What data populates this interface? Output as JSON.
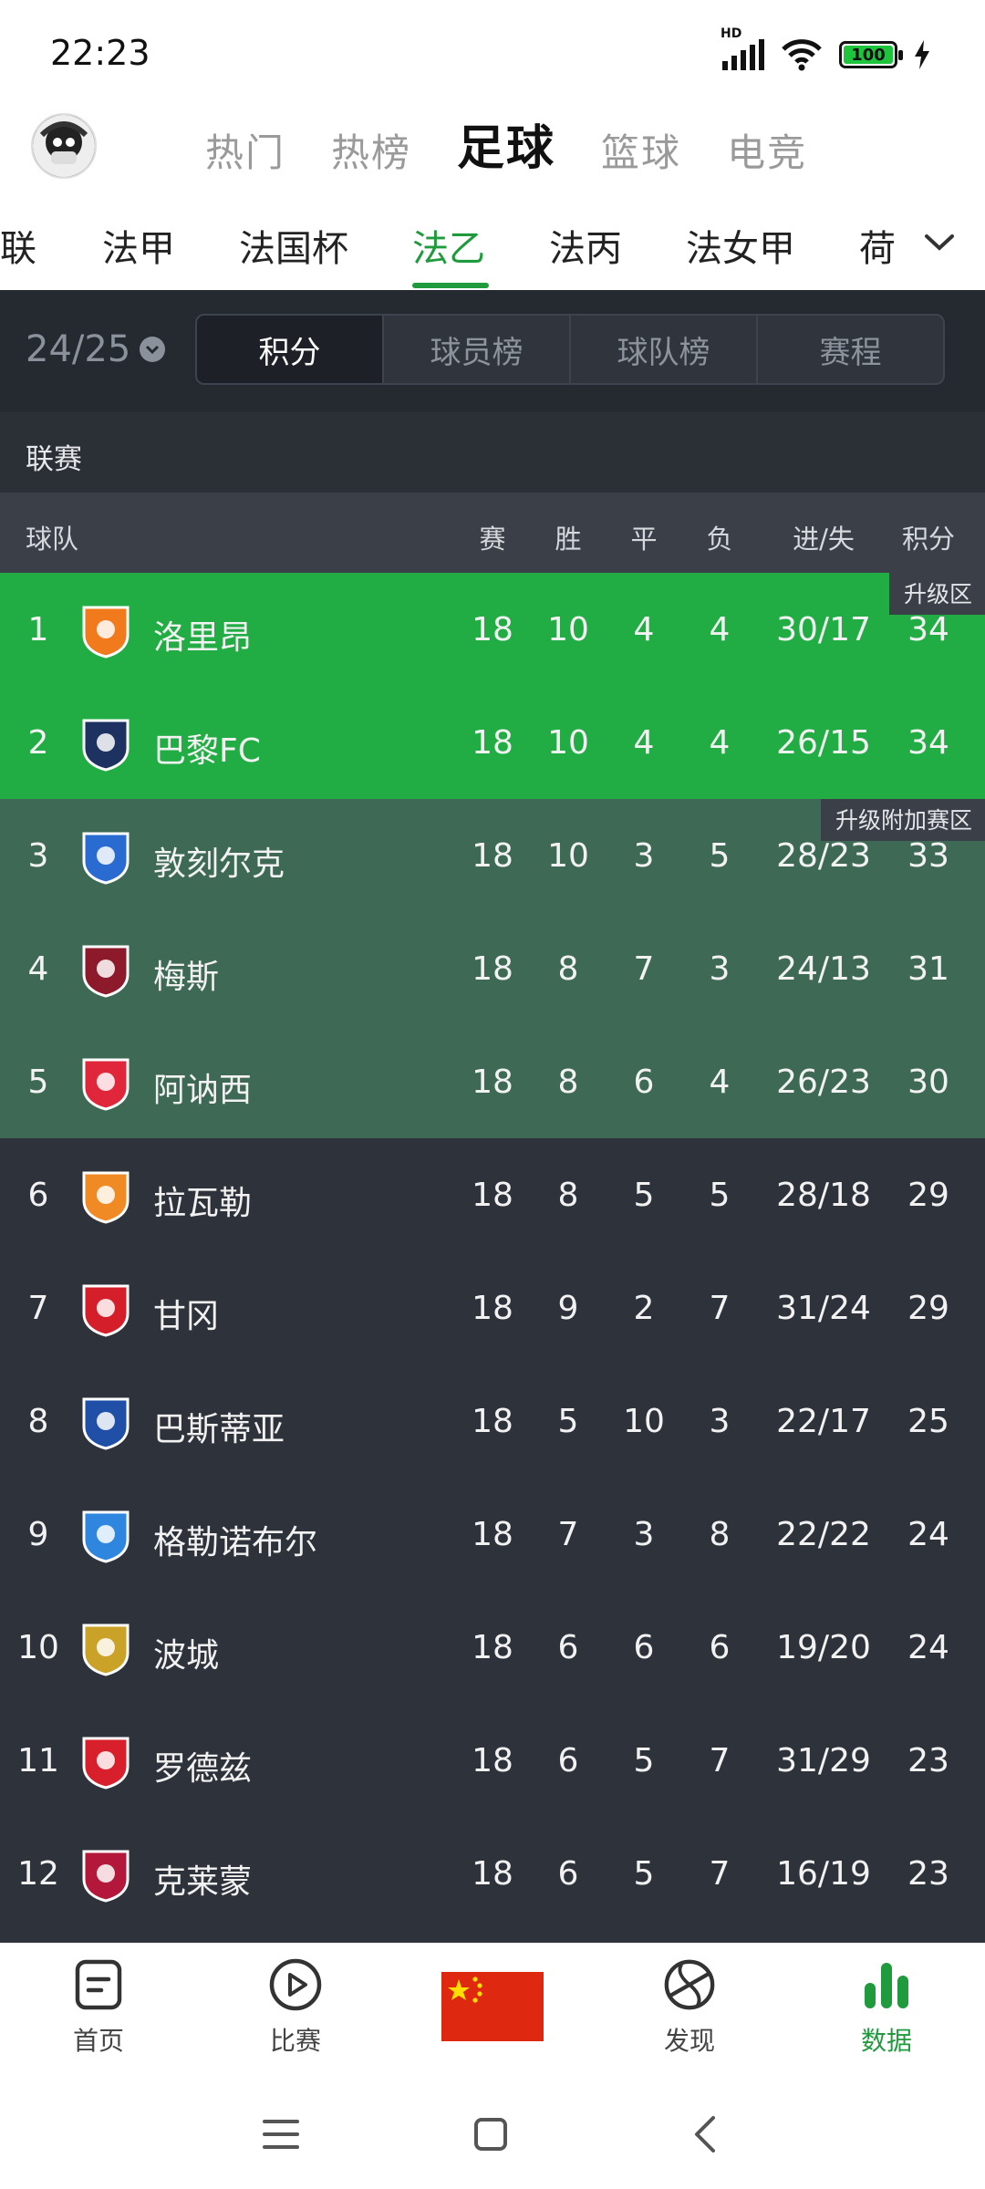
{
  "status": {
    "time": "22:23",
    "hd": "HD",
    "battery": "100"
  },
  "top_categories": [
    {
      "label": "热门",
      "active": false
    },
    {
      "label": "热榜",
      "active": false
    },
    {
      "label": "足球",
      "active": true
    },
    {
      "label": "篮球",
      "active": false
    },
    {
      "label": "电竞",
      "active": false
    }
  ],
  "league_tabs": [
    {
      "label": "联",
      "active": false
    },
    {
      "label": "法甲",
      "active": false
    },
    {
      "label": "法国杯",
      "active": false
    },
    {
      "label": "法乙",
      "active": true
    },
    {
      "label": "法丙",
      "active": false
    },
    {
      "label": "法女甲",
      "active": false
    },
    {
      "label": "荷",
      "active": false
    }
  ],
  "season": "24/25",
  "segments": [
    {
      "label": "积分",
      "active": true
    },
    {
      "label": "球员榜",
      "active": false
    },
    {
      "label": "球队榜",
      "active": false
    },
    {
      "label": "赛程",
      "active": false
    }
  ],
  "section_title": "联赛",
  "columns": {
    "team": "球队",
    "played": "赛",
    "win": "胜",
    "draw": "平",
    "loss": "负",
    "goals": "进/失",
    "points": "积分"
  },
  "zones": {
    "promotion": "升级区",
    "playoff": "升级附加赛区"
  },
  "standings": [
    {
      "rank": "1",
      "team": "洛里昂",
      "played": "18",
      "win": "10",
      "draw": "4",
      "loss": "4",
      "goals": "30/17",
      "points": "34",
      "zone": "promo",
      "crest": "lorient-crest-icon",
      "color": "#f07a1c"
    },
    {
      "rank": "2",
      "team": "巴黎FC",
      "played": "18",
      "win": "10",
      "draw": "4",
      "loss": "4",
      "goals": "26/15",
      "points": "34",
      "zone": "promo",
      "crest": "paris-fc-crest-icon",
      "color": "#1e3262"
    },
    {
      "rank": "3",
      "team": "敦刻尔克",
      "played": "18",
      "win": "10",
      "draw": "3",
      "loss": "5",
      "goals": "28/23",
      "points": "33",
      "zone": "playoff",
      "crest": "dunkerque-crest-icon",
      "color": "#2a6bd1"
    },
    {
      "rank": "4",
      "team": "梅斯",
      "played": "18",
      "win": "8",
      "draw": "7",
      "loss": "3",
      "goals": "24/13",
      "points": "31",
      "zone": "playoff",
      "crest": "metz-crest-icon",
      "color": "#8d1a2a"
    },
    {
      "rank": "5",
      "team": "阿讷西",
      "played": "18",
      "win": "8",
      "draw": "6",
      "loss": "4",
      "goals": "26/23",
      "points": "30",
      "zone": "playoff",
      "crest": "annecy-crest-icon",
      "color": "#e0263a"
    },
    {
      "rank": "6",
      "team": "拉瓦勒",
      "played": "18",
      "win": "8",
      "draw": "5",
      "loss": "5",
      "goals": "28/18",
      "points": "29",
      "zone": "normal",
      "crest": "laval-crest-icon",
      "color": "#f08a24"
    },
    {
      "rank": "7",
      "team": "甘冈",
      "played": "18",
      "win": "9",
      "draw": "2",
      "loss": "7",
      "goals": "31/24",
      "points": "29",
      "zone": "normal",
      "crest": "guingamp-crest-icon",
      "color": "#d41f2b"
    },
    {
      "rank": "8",
      "team": "巴斯蒂亚",
      "played": "18",
      "win": "5",
      "draw": "10",
      "loss": "3",
      "goals": "22/17",
      "points": "25",
      "zone": "normal",
      "crest": "bastia-crest-icon",
      "color": "#1f4fa6"
    },
    {
      "rank": "9",
      "team": "格勒诺布尔",
      "played": "18",
      "win": "7",
      "draw": "3",
      "loss": "8",
      "goals": "22/22",
      "points": "24",
      "zone": "normal",
      "crest": "grenoble-crest-icon",
      "color": "#2e86de"
    },
    {
      "rank": "10",
      "team": "波城",
      "played": "18",
      "win": "6",
      "draw": "6",
      "loss": "6",
      "goals": "19/20",
      "points": "24",
      "zone": "normal",
      "crest": "pau-crest-icon",
      "color": "#c9a227"
    },
    {
      "rank": "11",
      "team": "罗德兹",
      "played": "18",
      "win": "6",
      "draw": "5",
      "loss": "7",
      "goals": "31/29",
      "points": "23",
      "zone": "normal",
      "crest": "rodez-crest-icon",
      "color": "#d8202c"
    },
    {
      "rank": "12",
      "team": "克莱蒙",
      "played": "18",
      "win": "6",
      "draw": "5",
      "loss": "7",
      "goals": "16/19",
      "points": "23",
      "zone": "normal",
      "crest": "clermont-crest-icon",
      "color": "#b3173a"
    }
  ],
  "tabbar": [
    {
      "label": "首页",
      "icon": "home-doc-icon",
      "active": false
    },
    {
      "label": "比赛",
      "icon": "play-circle-icon",
      "active": false
    },
    {
      "label": "",
      "icon": "china-flag-icon",
      "active": false
    },
    {
      "label": "发现",
      "icon": "discover-ball-icon",
      "active": false
    },
    {
      "label": "数据",
      "icon": "bar-chart-icon",
      "active": true
    }
  ],
  "colors": {
    "accent": "#1f9a3c",
    "promo": "#22ad44",
    "playoff": "#3e6a55",
    "panel": "#2e333b"
  }
}
